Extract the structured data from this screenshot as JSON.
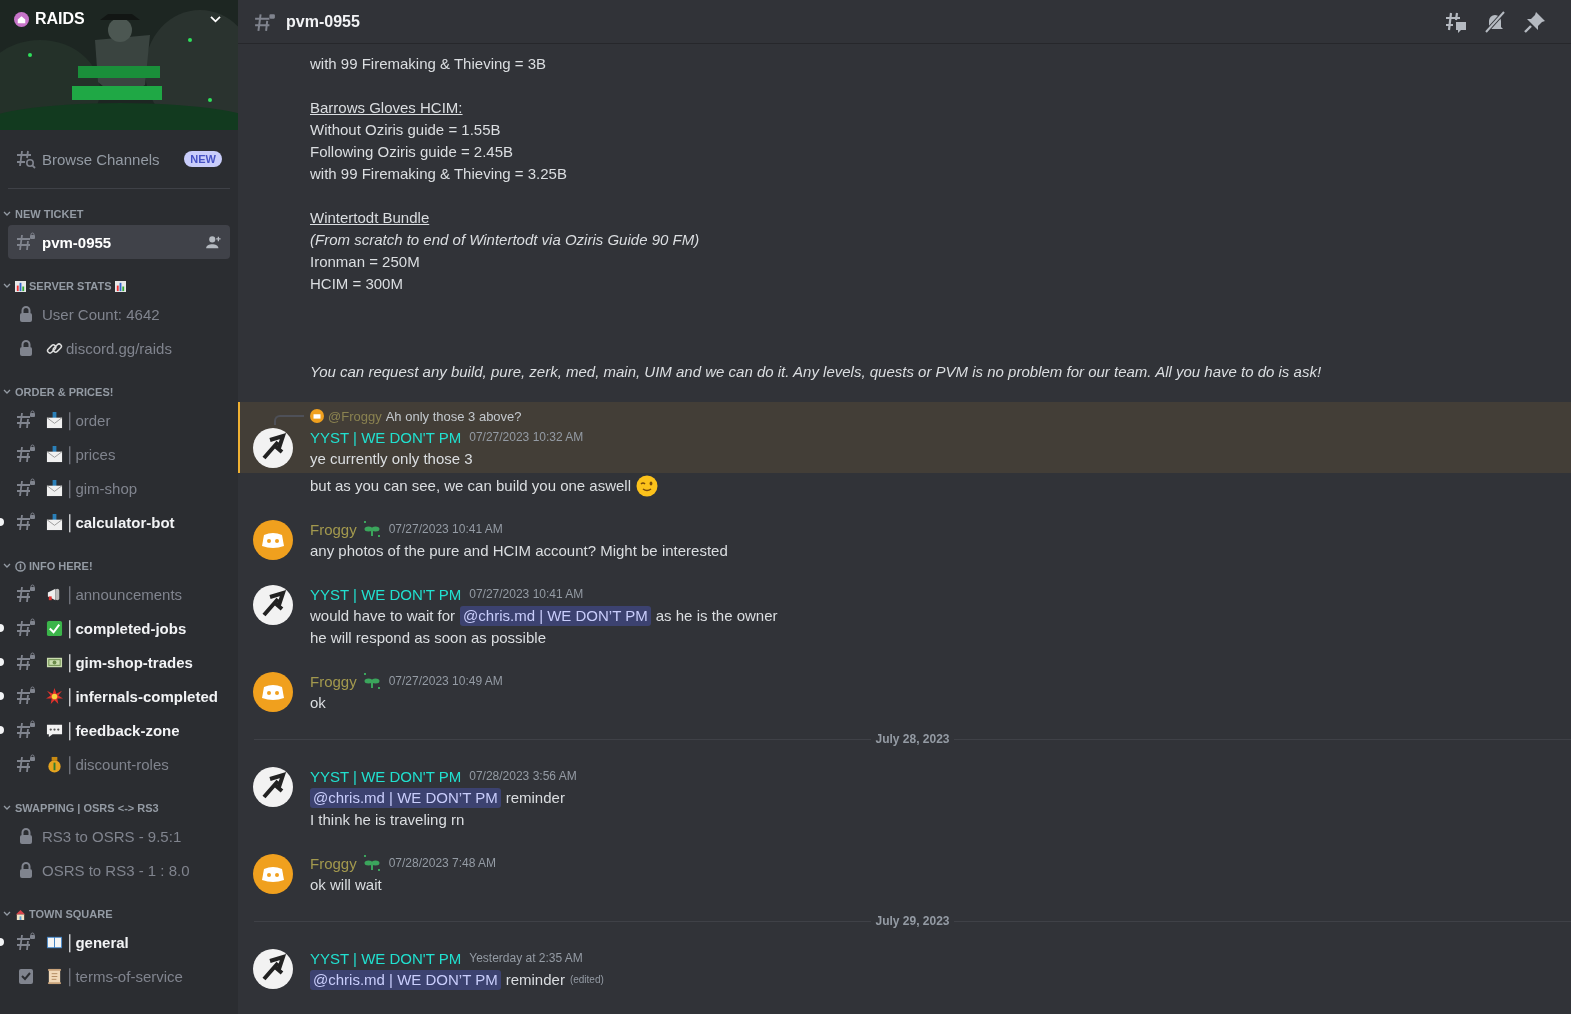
{
  "server": {
    "name": "RAIDS"
  },
  "sidebar": {
    "browse": {
      "label": "Browse Channels",
      "badge": "NEW"
    },
    "categories": [
      {
        "name": "NEW TICKET",
        "channels": [
          {
            "kind": "text",
            "name": "pvm-0955",
            "selected": true,
            "unread": false
          }
        ]
      },
      {
        "name": "SERVER STATS",
        "lead_icon": {
          "kind": "chart"
        },
        "trail_icon": {
          "kind": "chart"
        },
        "channels": [
          {
            "kind": "locked",
            "name": "User Count: 4642",
            "selected": false,
            "unread": false
          },
          {
            "kind": "locked",
            "emoji": {
              "kind": "link"
            },
            "name": "discord.gg/raids",
            "selected": false,
            "unread": false
          }
        ]
      },
      {
        "name": "ORDER & PRICES!",
        "channels": [
          {
            "kind": "text",
            "emoji": {
              "kind": "envelope"
            },
            "name": "│order",
            "selected": false,
            "unread": false
          },
          {
            "kind": "text",
            "emoji": {
              "kind": "envelope"
            },
            "name": "│prices",
            "selected": false,
            "unread": false
          },
          {
            "kind": "text",
            "emoji": {
              "kind": "envelope"
            },
            "name": "│gim-shop",
            "selected": false,
            "unread": false
          },
          {
            "kind": "text",
            "emoji": {
              "kind": "envelope"
            },
            "name": "│calculator-bot",
            "selected": false,
            "unread": true
          }
        ]
      },
      {
        "name": "INFO HERE!",
        "lead_icon": {
          "kind": "info"
        },
        "channels": [
          {
            "kind": "text",
            "emoji": {
              "kind": "megaphone"
            },
            "name": "│announcements",
            "selected": false,
            "unread": false
          },
          {
            "kind": "text",
            "emoji": {
              "kind": "check"
            },
            "name": "│completed-jobs",
            "selected": false,
            "unread": true
          },
          {
            "kind": "text",
            "emoji": {
              "kind": "money"
            },
            "name": "│gim-shop-trades",
            "selected": false,
            "unread": true
          },
          {
            "kind": "text",
            "emoji": {
              "kind": "burst"
            },
            "name": "│infernals-completed",
            "selected": false,
            "unread": true
          },
          {
            "kind": "text",
            "emoji": {
              "kind": "speech"
            },
            "name": "│feedback-zone",
            "selected": false,
            "unread": true
          },
          {
            "kind": "text",
            "emoji": {
              "kind": "moneybag"
            },
            "name": "│discount-roles",
            "selected": false,
            "unread": false
          }
        ]
      },
      {
        "name": "SWAPPING | OSRS <-> RS3",
        "channels": [
          {
            "kind": "locked",
            "name": "RS3 to OSRS - 9.5:1",
            "selected": false,
            "unread": false
          },
          {
            "kind": "locked",
            "name": "OSRS to RS3 - 1 : 8.0",
            "selected": false,
            "unread": false
          }
        ]
      },
      {
        "name": "TOWN SQUARE",
        "lead_icon": {
          "kind": "house"
        },
        "channels": [
          {
            "kind": "text",
            "emoji": {
              "kind": "book"
            },
            "name": "│general",
            "selected": false,
            "unread": true
          },
          {
            "kind": "rules",
            "emoji": {
              "kind": "scroll"
            },
            "name": "│terms-of-service",
            "selected": false,
            "unread": false
          }
        ]
      }
    ]
  },
  "channel_header": {
    "name": "pvm-0955"
  },
  "messages": [
    {
      "kind": "continuation",
      "highlighted": false,
      "lines": [
        {
          "kind": "text",
          "parts": [
            {
              "kind": "text",
              "text": "with 99 Firemaking & Thieving = 3B"
            }
          ]
        },
        {
          "kind": "spacer"
        },
        {
          "kind": "text",
          "parts": [
            {
              "kind": "heading",
              "text": "Barrows Gloves HCIM:"
            }
          ]
        },
        {
          "kind": "text",
          "parts": [
            {
              "kind": "text",
              "text": "Without Oziris guide = 1.55B"
            }
          ]
        },
        {
          "kind": "text",
          "parts": [
            {
              "kind": "text",
              "text": "Following Oziris  guide = 2.45B"
            }
          ]
        },
        {
          "kind": "text",
          "parts": [
            {
              "kind": "text",
              "text": "with 99 Firemaking & Thieving = 3.25B"
            }
          ]
        },
        {
          "kind": "spacer"
        },
        {
          "kind": "text",
          "parts": [
            {
              "kind": "heading",
              "text": "Wintertodt Bundle"
            }
          ]
        },
        {
          "kind": "text",
          "parts": [
            {
              "kind": "italic",
              "text": "(From scratch to end of Wintertodt via Oziris Guide 90 FM)"
            }
          ]
        },
        {
          "kind": "text",
          "parts": [
            {
              "kind": "text",
              "text": "Ironman = 250M"
            }
          ]
        },
        {
          "kind": "text",
          "parts": [
            {
              "kind": "text",
              "text": "HCIM = 300M"
            }
          ]
        },
        {
          "kind": "spacer"
        },
        {
          "kind": "spacer"
        },
        {
          "kind": "spacer"
        },
        {
          "kind": "text",
          "parts": [
            {
              "kind": "italic",
              "text": "You can request any build, pure, zerk, med, main, UIM and we can do it. Any levels, quests or PVM is no problem for our team. All you have to do is ask!"
            }
          ]
        }
      ]
    },
    {
      "kind": "message",
      "highlighted": true,
      "author": {
        "kind": "staff",
        "name": "YYST | WE DON'T PM"
      },
      "time": "07/27/2023 10:32 AM",
      "reply": {
        "author": "@Froggy",
        "text": "Ah only those 3 above?"
      },
      "lines": [
        {
          "kind": "text",
          "parts": [
            {
              "kind": "text",
              "text": "ye currently only those 3"
            }
          ]
        }
      ]
    },
    {
      "kind": "continuation",
      "highlighted": false,
      "lines": [
        {
          "kind": "text",
          "parts": [
            {
              "kind": "text",
              "text": "but as you can see, we can build you one aswell"
            },
            {
              "kind": "emoji"
            }
          ]
        }
      ]
    },
    {
      "kind": "message",
      "highlighted": false,
      "author": {
        "kind": "member",
        "name": "Froggy"
      },
      "time": "07/27/2023 10:41 AM",
      "lines": [
        {
          "kind": "text",
          "parts": [
            {
              "kind": "text",
              "text": "any photos of the pure and HCIM account? Might be interested"
            }
          ]
        }
      ]
    },
    {
      "kind": "message",
      "highlighted": false,
      "author": {
        "kind": "staff",
        "name": "YYST | WE DON'T PM"
      },
      "time": "07/27/2023 10:41 AM",
      "lines": [
        {
          "kind": "text",
          "parts": [
            {
              "kind": "text",
              "text": "would have to wait for"
            },
            {
              "kind": "mention",
              "text": "@chris.md | WE DON’T PM"
            },
            {
              "kind": "text",
              "text": "as he is the owner"
            }
          ]
        },
        {
          "kind": "text",
          "parts": [
            {
              "kind": "text",
              "text": "he will respond as soon as possible"
            }
          ]
        }
      ]
    },
    {
      "kind": "message",
      "highlighted": false,
      "author": {
        "kind": "member",
        "name": "Froggy"
      },
      "time": "07/27/2023 10:49 AM",
      "lines": [
        {
          "kind": "text",
          "parts": [
            {
              "kind": "text",
              "text": "ok"
            }
          ]
        }
      ]
    },
    {
      "kind": "divider",
      "text": "July 28, 2023"
    },
    {
      "kind": "message",
      "highlighted": false,
      "author": {
        "kind": "staff",
        "name": "YYST | WE DON'T PM"
      },
      "time": "07/28/2023 3:56 AM",
      "lines": [
        {
          "kind": "text",
          "parts": [
            {
              "kind": "mention",
              "text": "@chris.md | WE DON’T PM"
            },
            {
              "kind": "text",
              "text": "reminder"
            }
          ]
        },
        {
          "kind": "text",
          "parts": [
            {
              "kind": "text",
              "text": "I think he is traveling rn"
            }
          ]
        }
      ]
    },
    {
      "kind": "message",
      "highlighted": false,
      "author": {
        "kind": "member",
        "name": "Froggy"
      },
      "time": "07/28/2023 7:48 AM",
      "lines": [
        {
          "kind": "text",
          "parts": [
            {
              "kind": "text",
              "text": "ok will wait"
            }
          ]
        }
      ]
    },
    {
      "kind": "divider",
      "text": "July 29, 2023"
    },
    {
      "kind": "message",
      "highlighted": false,
      "author": {
        "kind": "staff",
        "name": "YYST | WE DON'T PM"
      },
      "time": "Yesterday at 2:35 AM",
      "lines": [
        {
          "kind": "text",
          "parts": [
            {
              "kind": "mention",
              "text": "@chris.md | WE DON’T PM"
            },
            {
              "kind": "text",
              "text": "reminder"
            },
            {
              "kind": "edited",
              "text": "(edited)"
            }
          ]
        }
      ]
    }
  ]
}
